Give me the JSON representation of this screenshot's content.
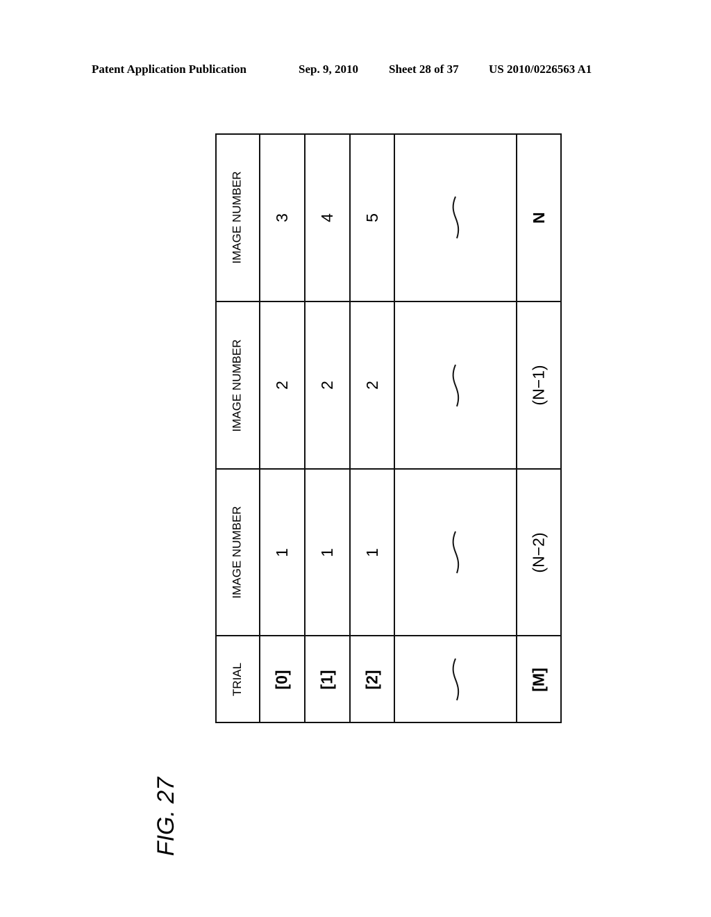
{
  "header": {
    "publication": "Patent Application Publication",
    "date": "Sep. 9, 2010",
    "sheet": "Sheet 28 of 37",
    "number": "US 2010/0226563 A1"
  },
  "figure_label": "FIG. 27",
  "table": {
    "columns": [
      "TRIAL",
      "IMAGE NUMBER",
      "IMAGE NUMBER",
      "IMAGE NUMBER"
    ],
    "rows": [
      [
        "[0]",
        "1",
        "2",
        "3"
      ],
      [
        "[1]",
        "1",
        "2",
        "4"
      ],
      [
        "[2]",
        "1",
        "2",
        "5"
      ],
      [
        "~",
        "~",
        "~",
        "~"
      ],
      [
        "[M]",
        "(N−2)",
        "(N−1)",
        "N"
      ]
    ]
  }
}
